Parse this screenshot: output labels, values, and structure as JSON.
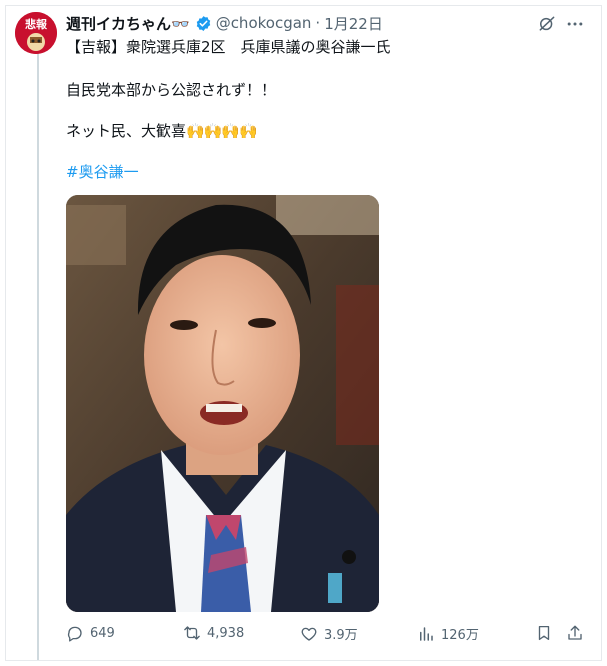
{
  "tweet": {
    "author_name": "週刊イカちゃん👓",
    "handle": "@chokocgan",
    "separator": "·",
    "date": "1月22日",
    "lines": [
      "【吉報】衆院選兵庫2区　兵庫県議の奥谷謙一氏",
      "自民党本部から公認されず！！",
      "ネット民、大歓喜"
    ],
    "claps": "🙌🙌🙌🙌",
    "hashtag": "#奥谷謙一"
  },
  "avatar": {
    "label_top": "悲報",
    "color": "#c8102e"
  },
  "actions": {
    "replies": "649",
    "retweets": "4,938",
    "likes": "3.9万",
    "views": "126万"
  },
  "icons": [
    "grok-icon",
    "more-icon",
    "reply-icon",
    "retweet-icon",
    "like-icon",
    "views-icon",
    "bookmark-icon",
    "share-icon",
    "verified-icon"
  ],
  "colors": {
    "accent": "#1d9bf0",
    "muted": "#536471",
    "text": "#0f1419"
  }
}
